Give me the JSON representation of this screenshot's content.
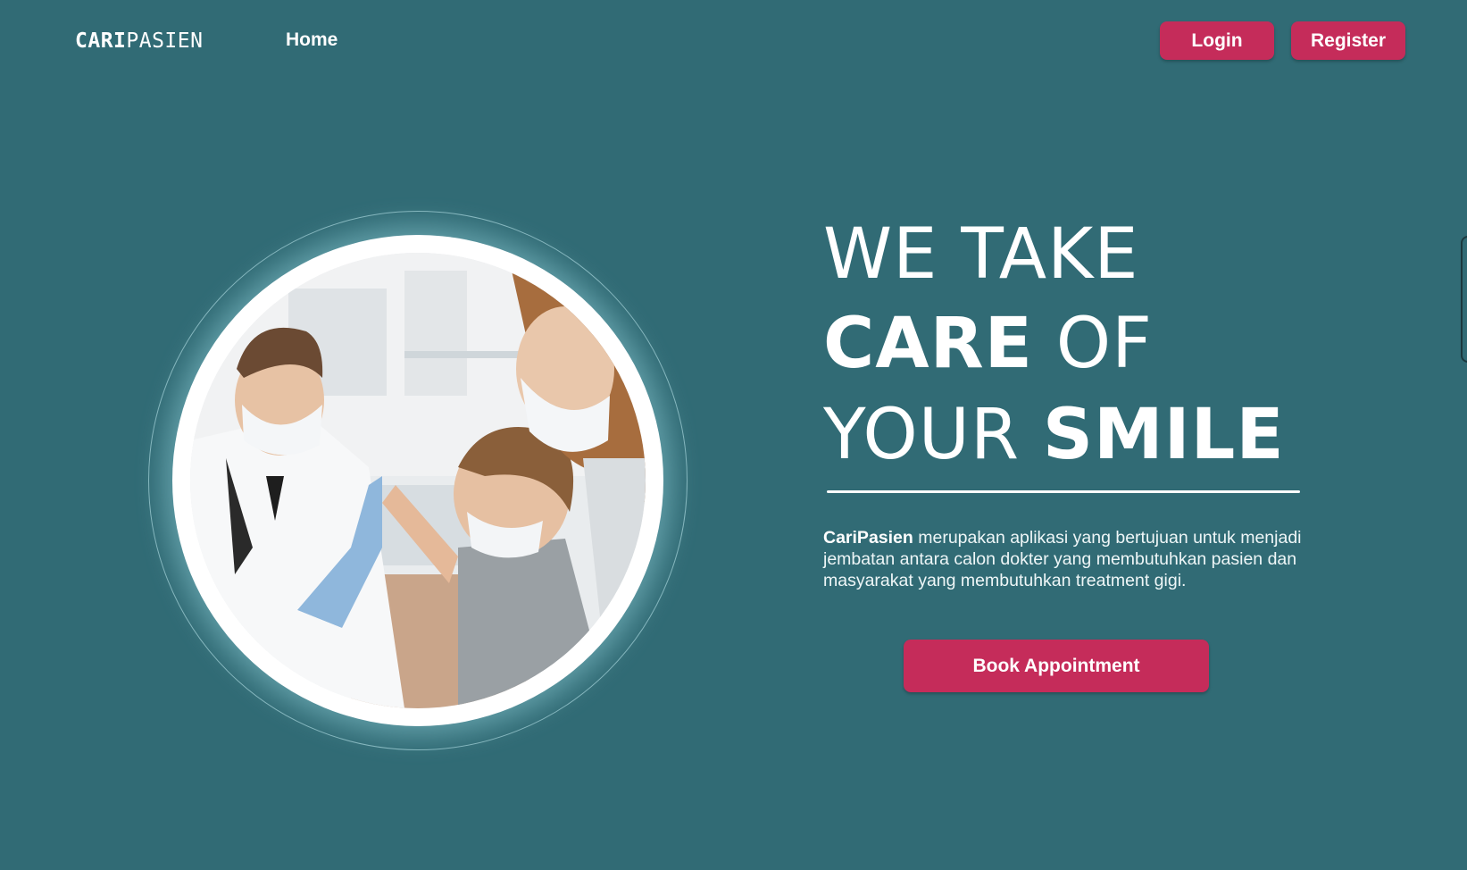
{
  "header": {
    "logo": {
      "bold_part": "CARI",
      "light_part": "PASIEN"
    },
    "nav": [
      {
        "label": "Home"
      }
    ],
    "login_label": "Login",
    "register_label": "Register"
  },
  "hero": {
    "headline": {
      "line1": "WE TAKE",
      "line2_bold": "CARE",
      "line2_light": " OF",
      "line3_light": "YOUR ",
      "line3_bold": "SMILE"
    },
    "description": {
      "brand": "CariPasien",
      "text": " merupakan aplikasi yang bertujuan untuk menjadi jembatan antara calon dokter yang membutuhkan pasien dan masyarakat yang membutuhkan treatment gigi."
    },
    "cta_label": "Book Appointment",
    "image": {
      "subject": "doctor high-fiving a child patient",
      "icon": "photo"
    }
  },
  "colors": {
    "background": "#316b75",
    "accent": "#c52c5a",
    "text": "#ffffff"
  }
}
